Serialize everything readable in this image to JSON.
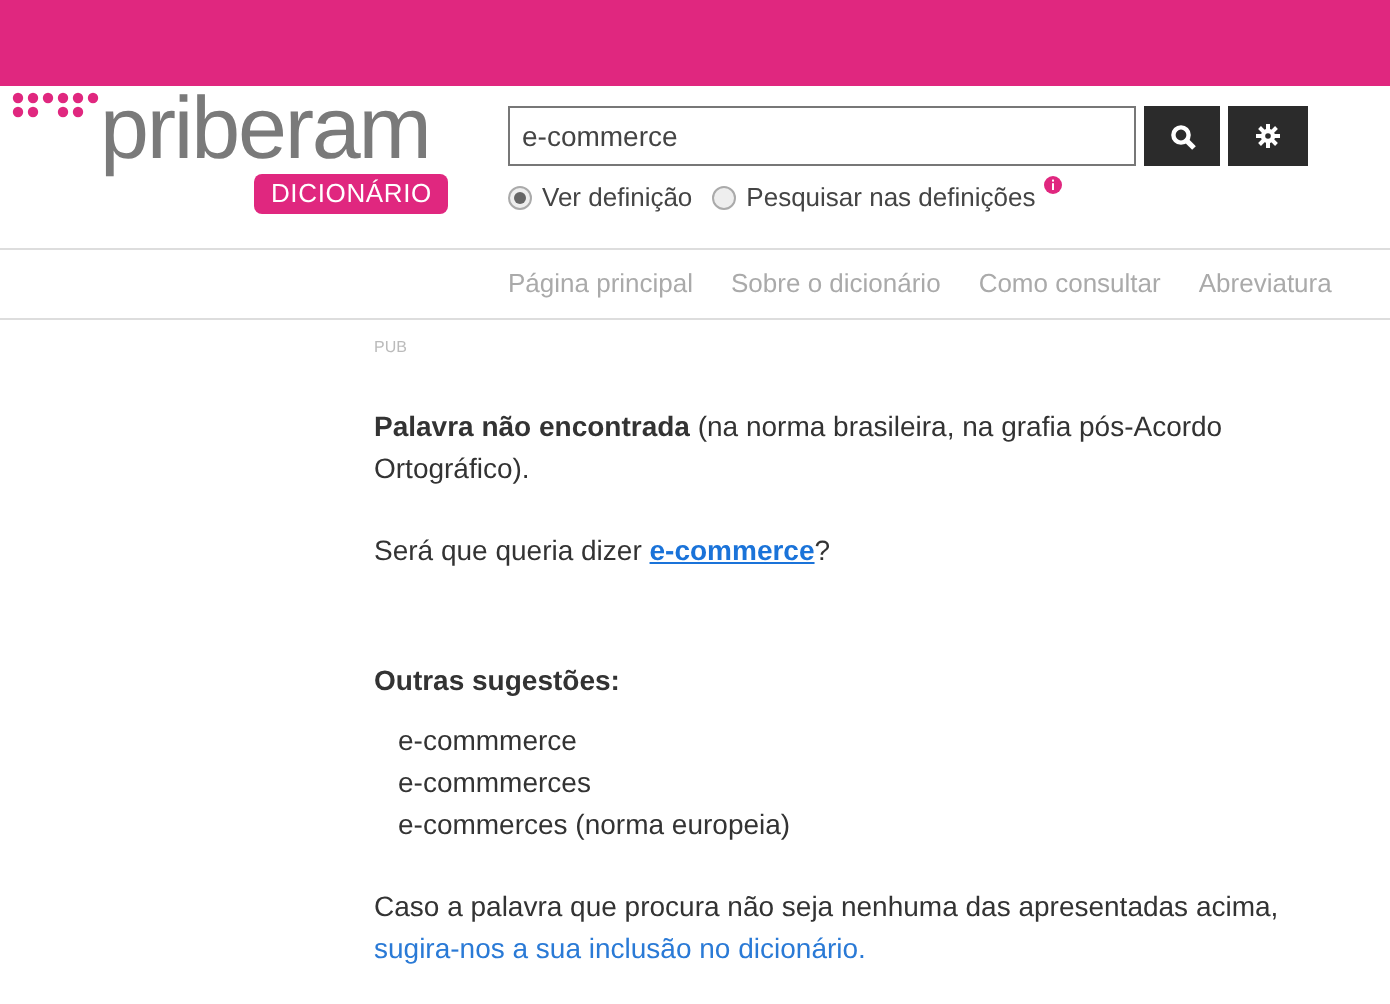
{
  "logo": {
    "name": "priberam",
    "badge": "DICIONÁRIO"
  },
  "search": {
    "value": "e-commerce"
  },
  "search_modes": [
    {
      "label": "Ver definição",
      "selected": true
    },
    {
      "label": "Pesquisar nas definições",
      "selected": false
    }
  ],
  "nav": [
    "Página principal",
    "Sobre o dicionário",
    "Como consultar",
    "Abreviatura"
  ],
  "ad_label": "PUB",
  "not_found": "**Palavra não encontrada** (na norma brasileira, na grafia pós-Acordo Ortográfico).",
  "did_you_mean": {
    "prefix": "Será que queria dizer ",
    "link": "e-commerce",
    "suffix": "?"
  },
  "suggestions_title": "Outras sugestões:",
  "suggestions": [
    "e-commmerce",
    "e-commmerces",
    "e-commerces (norma europeia)"
  ],
  "footer": {
    "text": "Caso a palavra que procura não seja nenhuma das apresentadas acima, ",
    "link": "sugira-nos a sua inclusão no dicionário."
  }
}
